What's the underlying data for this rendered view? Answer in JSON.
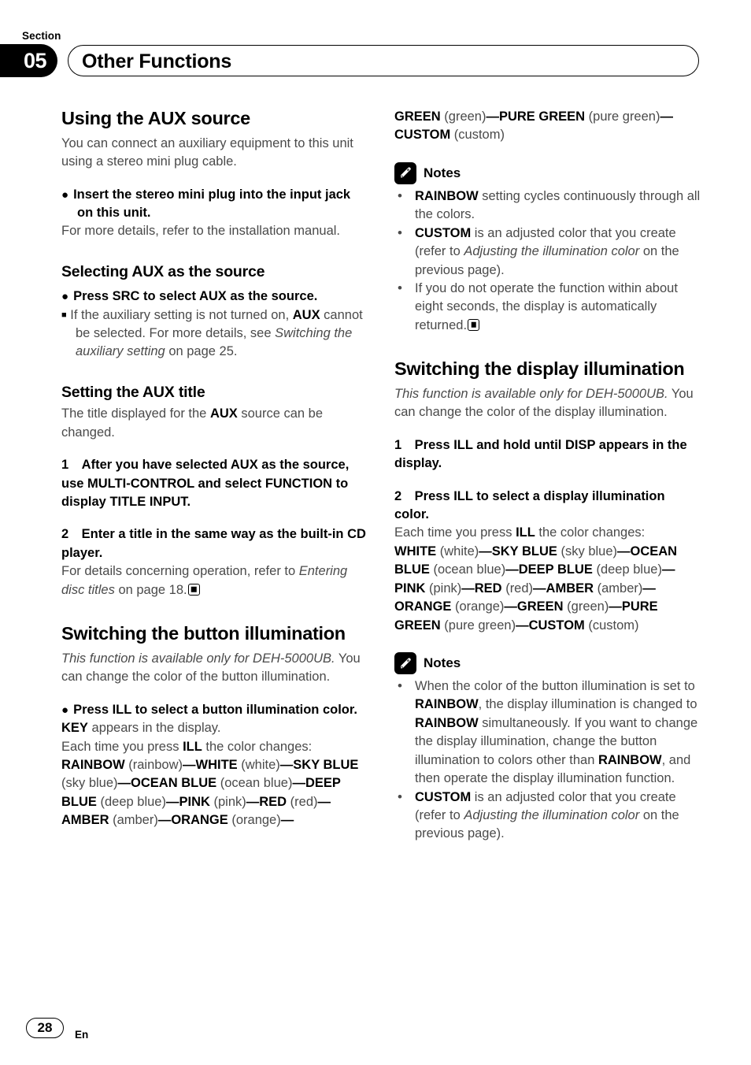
{
  "header": {
    "section_word": "Section",
    "section_number": "05",
    "title": "Other Functions"
  },
  "footer": {
    "page_number": "28",
    "language_code": "En"
  },
  "left_column": {
    "h1_aux_source": "Using the AUX source",
    "aux_intro": "You can connect an auxiliary equipment to this unit using a stereo mini plug cable.",
    "aux_instruction": "Insert the stereo mini plug into the input jack on this unit.",
    "aux_instruction_detail": "For more details, refer to the installation manual.",
    "h2_selecting_aux": "Selecting AUX as the source",
    "selecting_instruction": "Press SRC to select AUX as the source.",
    "selecting_note_a": "If the auxiliary setting is not turned on, ",
    "selecting_note_b": "AUX",
    "selecting_note_c": " cannot be selected. For more details, see ",
    "selecting_note_italic": "Switching the auxiliary setting",
    "selecting_note_d": " on page 25.",
    "h2_setting_title": "Setting the AUX title",
    "setting_title_intro_a": "The title displayed for the ",
    "setting_title_intro_b": "AUX",
    "setting_title_intro_c": " source can be changed.",
    "step1": "1 After you have selected AUX as the source, use MULTI-CONTROL and select FUNCTION to display TITLE INPUT.",
    "step2": "2 Enter a title in the same way as the built-in CD player.",
    "step2_detail_a": "For details concerning operation, refer to ",
    "step2_detail_italic": "Entering disc titles",
    "step2_detail_b": " on page 18.",
    "h1_button_illumination": "Switching the button illumination",
    "button_ill_italic": "This function is available only for DEH-5000UB.",
    "button_ill_intro": " You can change the color of the button illumination.",
    "button_ill_instruction": "Press ILL to select a button illumination color.",
    "button_ill_key_a": "KEY",
    "button_ill_key_b": " appears in the display.",
    "button_ill_each_a": "Each time you press ",
    "button_ill_each_b": "ILL",
    "button_ill_each_c": " the color changes:",
    "button_colors": [
      {
        "name": "RAINBOW",
        "label": "(rainbow)"
      },
      {
        "name": "WHITE",
        "label": "(white)"
      },
      {
        "name": "SKY BLUE",
        "label": "(sky blue)"
      },
      {
        "name": "OCEAN BLUE",
        "label": "(ocean blue)"
      },
      {
        "name": "DEEP BLUE",
        "label": "(deep blue)"
      },
      {
        "name": "PINK",
        "label": "(pink)"
      },
      {
        "name": "RED",
        "label": "(red)"
      },
      {
        "name": "AMBER",
        "label": "(amber)"
      },
      {
        "name": "ORANGE",
        "label": "(orange)"
      },
      {
        "name": "GREEN",
        "label": "(green)"
      },
      {
        "name": "PURE GREEN",
        "label": "(pure green)"
      },
      {
        "name": "CUSTOM",
        "label": "(custom)"
      }
    ]
  },
  "right_column": {
    "notes_label_1": "Notes",
    "note1_1_a": "RAINBOW",
    "note1_1_b": " setting cycles continuously through all the colors.",
    "note1_2_a": "CUSTOM",
    "note1_2_b": " is an adjusted color that you create (refer to ",
    "note1_2_italic": "Adjusting the illumination color",
    "note1_2_c": " on the previous page).",
    "note1_3": "If you do not operate the function within about eight seconds, the display is automatically returned.",
    "h1_display_illumination": "Switching the display illumination",
    "display_ill_italic": "This function is available only for DEH-5000UB.",
    "display_ill_intro": " You can change the color of the display illumination.",
    "step1": "1 Press ILL and hold until DISP appears in the display.",
    "step2": "2 Press ILL to select a display illumination color.",
    "display_each_a": "Each time you press ",
    "display_each_b": "ILL",
    "display_each_c": " the color changes:",
    "notes_label_2": "Notes",
    "note2_1_a": "When the color of the button illumination is set to ",
    "note2_1_b": "RAINBOW",
    "note2_1_c": ", the display illumination is changed to ",
    "note2_1_d": "RAINBOW",
    "note2_1_e": " simultaneously. If you want to change the display illumination, change the button illumination to colors other than ",
    "note2_1_f": "RAINBOW",
    "note2_1_g": ", and then operate the display illumination function.",
    "note2_2_a": "CUSTOM",
    "note2_2_b": " is an adjusted color that you create (refer to ",
    "note2_2_italic": "Adjusting the illumination color",
    "note2_2_c": " on the previous page)."
  },
  "icons": {
    "notes": "pencil-icon",
    "end_marker": "end-of-section-square"
  },
  "colors": {
    "body_text": "#4a4a4a",
    "heading_text": "#000000",
    "badge_background": "#000000",
    "page_background": "#ffffff"
  }
}
